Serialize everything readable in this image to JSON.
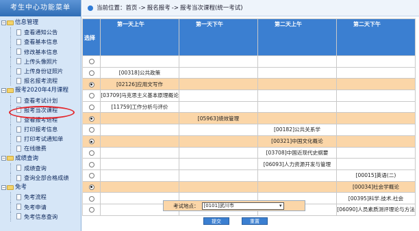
{
  "sidebar": {
    "title": "考生中心功能菜单",
    "groups": [
      {
        "label": "信息管理",
        "items": [
          "查看通知公告",
          "查看基本信息",
          "修改基本信息",
          "上传头像照片",
          "上传身份证照片",
          "报名报考流程"
        ]
      },
      {
        "label": "报考2020年4月课程",
        "items": [
          "查看考试计划",
          "报考当次课程",
          "查看报考进程",
          "打印报考信息",
          "打印考试通知单",
          "在线缴费"
        ]
      },
      {
        "label": "成绩查询",
        "items": [
          "成绩查询",
          "查询全部合格成绩"
        ]
      },
      {
        "label": "免考",
        "items": [
          "免考流程",
          "免考申请",
          "免考信息查询"
        ]
      }
    ]
  },
  "breadcrumb": {
    "prefix": "当前位置：",
    "crumbs": [
      "首页",
      "报名报考",
      "报考当次课程(统一考试)"
    ],
    "separator": "->"
  },
  "grid": {
    "select_header": "选择",
    "columns": [
      "第一天上午",
      "第一天下午",
      "第二天上午",
      "第二天下午"
    ],
    "rows": [
      {
        "selected": false,
        "highlight": false,
        "slot": 0,
        "course": ""
      },
      {
        "selected": false,
        "highlight": false,
        "slot": 0,
        "course": "[00318]公共政策"
      },
      {
        "selected": true,
        "highlight": true,
        "slot": 0,
        "course": "[02126]应用文写作"
      },
      {
        "selected": false,
        "highlight": false,
        "slot": 0,
        "course": "[03709]马克思主义基本原理概论"
      },
      {
        "selected": false,
        "highlight": false,
        "slot": 0,
        "course": "[11759]工作分析与评价"
      },
      {
        "selected": true,
        "highlight": true,
        "slot": 1,
        "course": "[05963]绩效管理"
      },
      {
        "selected": false,
        "highlight": false,
        "slot": 2,
        "course": "[00182]公共关系学"
      },
      {
        "selected": true,
        "highlight": true,
        "slot": 2,
        "course": "[00321]中国文化概论"
      },
      {
        "selected": false,
        "highlight": false,
        "slot": 2,
        "course": "[03708]中国近现代史纲要"
      },
      {
        "selected": false,
        "highlight": false,
        "slot": 2,
        "course": "[06093]人力资源开发与管理"
      },
      {
        "selected": false,
        "highlight": false,
        "slot": 3,
        "course": "[00015]英语(二)"
      },
      {
        "selected": true,
        "highlight": true,
        "slot": 3,
        "course": "[00034]社会学概论"
      },
      {
        "selected": false,
        "highlight": false,
        "slot": 3,
        "course": "[00395]科学.技术.社会"
      },
      {
        "selected": false,
        "highlight": false,
        "slot": 3,
        "course": "[06090]人员素质测评理论与方法"
      }
    ]
  },
  "form": {
    "location_label": "考试地点：",
    "location_value": "[0101]武川市",
    "submit_label": "提交",
    "reset_label": "重置"
  },
  "colors": {
    "header_blue": "#3b7fd1",
    "highlight_row": "#fbd6a8",
    "annotation_red": "#e4262b"
  }
}
